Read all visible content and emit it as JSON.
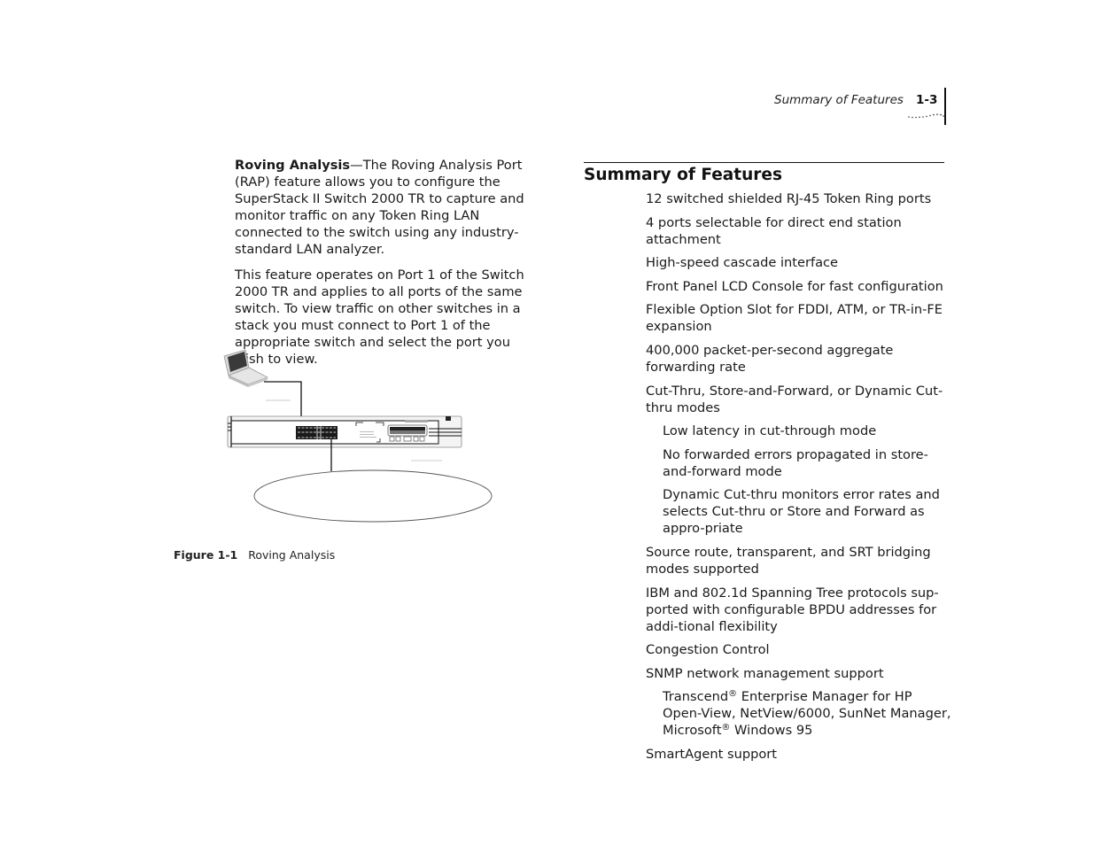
{
  "header": {
    "running_head": "Summary of Features",
    "page_number": "1-3"
  },
  "left_column": {
    "para1_lead": "Roving Analysis",
    "para1_body": "—The Roving Analysis Port (RAP) feature allows you to configure the SuperStack II Switch 2000 TR to capture and monitor traffic on any Token Ring LAN connected to the switch using any industry-standard LAN analyzer.",
    "para2": "This feature operates on Port 1 of the Switch 2000 TR and applies to all ports of the same switch. To view traffic on other switches in a stack you must connect to Port 1 of the appropriate switch and select the port you wish to view."
  },
  "figure": {
    "number": "Figure 1-1",
    "caption": "Roving Analysis",
    "elements": [
      "laptop-icon",
      "switch-front-panel",
      "token-ring-lan-ellipse"
    ]
  },
  "section": {
    "title": "Summary of Features",
    "features": [
      {
        "text": "12 switched shielded RJ-45 Token Ring ports",
        "level": 0
      },
      {
        "text": "4 ports selectable for direct end station attachment",
        "level": 0
      },
      {
        "text": "High-speed cascade interface",
        "level": 0
      },
      {
        "text": "Front Panel LCD Console for fast configuration",
        "level": 0
      },
      {
        "text": "Flexible Option Slot for FDDI, ATM, or TR-in-FE expansion",
        "level": 0
      },
      {
        "text": "400,000 packet-per-second aggregate forwarding rate",
        "level": 0
      },
      {
        "text": "Cut-Thru, Store-and-Forward, or Dynamic Cut-thru modes",
        "level": 0
      },
      {
        "text": "Low latency in cut-through mode",
        "level": 1
      },
      {
        "text": "No forwarded errors propagated in store-and-forward mode",
        "level": 1
      },
      {
        "text": "Dynamic Cut-thru monitors error rates and selects Cut-thru or Store and Forward as appro-priate",
        "level": 1
      },
      {
        "text": "Source route, transparent, and SRT bridging modes supported",
        "level": 0
      },
      {
        "text": "IBM and 802.1d Spanning Tree protocols sup-ported with configurable BPDU addresses for addi-tional flexibility",
        "level": 0
      },
      {
        "text": "Congestion Control",
        "level": 0
      },
      {
        "text": "SNMP network management support",
        "level": 0
      },
      {
        "text": "Transcend® Enterprise Manager for HP Open-View, NetView/6000, SunNet Manager, Microsoft® Windows 95",
        "level": 1
      },
      {
        "text": "SmartAgent support",
        "level": 0
      }
    ]
  }
}
